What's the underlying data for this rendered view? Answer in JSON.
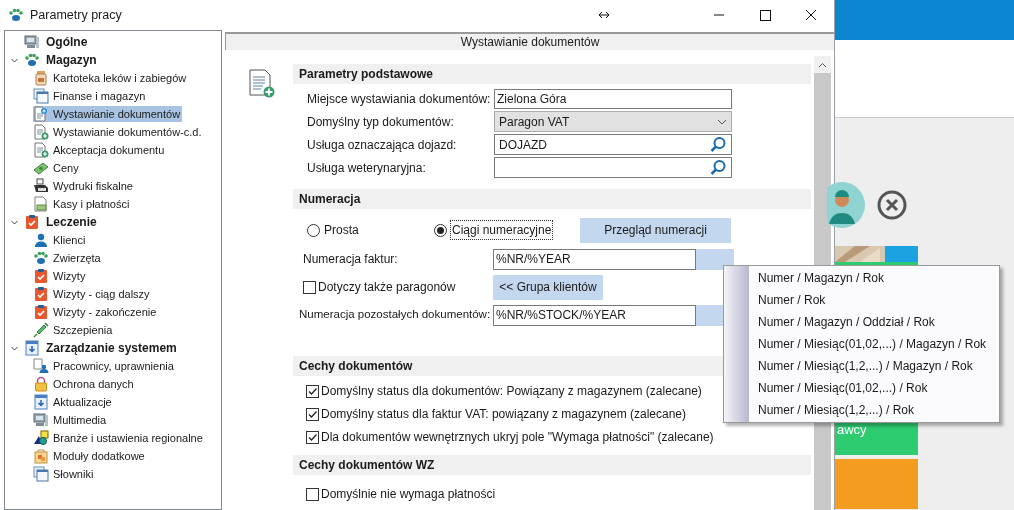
{
  "window": {
    "title": "Parametry pracy"
  },
  "tree": [
    {
      "label": "Ogólne",
      "selected": false
    },
    {
      "label": "Magazyn",
      "expanded": true,
      "selected": false,
      "children": [
        {
          "label": "Kartoteka leków i zabiegów",
          "selected": false
        },
        {
          "label": "Finanse i magazyn",
          "selected": false
        },
        {
          "label": "Wystawianie dokumentów",
          "selected": true
        },
        {
          "label": "Wystawianie dokumentów-c.d.",
          "selected": false
        },
        {
          "label": "Akceptacja dokumentu",
          "selected": false
        },
        {
          "label": "Ceny",
          "selected": false
        },
        {
          "label": "Wydruki fiskalne",
          "selected": false
        },
        {
          "label": "Kasy i płatności",
          "selected": false
        }
      ]
    },
    {
      "label": "Leczenie",
      "expanded": true,
      "selected": false,
      "children": [
        {
          "label": "Klienci",
          "selected": false
        },
        {
          "label": "Zwierzęta",
          "selected": false
        },
        {
          "label": "Wizyty",
          "selected": false
        },
        {
          "label": "Wizyty - ciąg dalszy",
          "selected": false
        },
        {
          "label": "Wizyty - zakończenie",
          "selected": false
        },
        {
          "label": "Szczepienia",
          "selected": false
        }
      ]
    },
    {
      "label": "Zarządzanie systemem",
      "expanded": true,
      "selected": false,
      "children": [
        {
          "label": "Pracownicy, uprawnienia",
          "selected": false
        },
        {
          "label": "Ochrona danych",
          "selected": false
        },
        {
          "label": "Aktualizacje",
          "selected": false
        },
        {
          "label": "Multimedia",
          "selected": false
        },
        {
          "label": "Branże i ustawienia regionalne",
          "selected": false
        },
        {
          "label": "Moduły dodatkowe",
          "selected": false
        },
        {
          "label": "Słowniki",
          "selected": false
        }
      ]
    }
  ],
  "panel": {
    "title": "Wystawianie dokumentów",
    "basic": {
      "title": "Parametry podstawowe",
      "fields": [
        {
          "kind": "text",
          "label": "Miejsce wystawiania dokumentów:",
          "value": "Zielona Góra"
        },
        {
          "kind": "select",
          "label": "Domyślny typ dokumentów:",
          "value": "Paragon VAT"
        },
        {
          "kind": "lookup",
          "label": "Usługa oznaczająca dojazd:",
          "value": "DOJAZD"
        },
        {
          "kind": "lookup",
          "label": "Usługa weterynaryjna:"
        }
      ]
    },
    "numbering": {
      "title": "Numeracja",
      "radios": [
        {
          "label": "Prosta",
          "selected": false
        },
        {
          "label": "Ciągi numeracyjne",
          "selected": true
        }
      ],
      "review_button": "Przegląd numeracji",
      "invoice_label": "Numeracja faktur:",
      "invoice_value": "%NR/%YEAR",
      "receipts_check": {
        "label": "Dotyczy także paragonów",
        "checked": false
      },
      "group_button": "<< Grupa klientów",
      "other_label": "Numeracja pozostałych dokumentów:",
      "other_value": "%NR/%STOCK/%YEAR"
    },
    "features": {
      "title": "Cechy dokumentów",
      "checks": [
        {
          "label": "Domyślny status dla dokumentów: Powiązany z magazynem (zalecane)",
          "checked": true
        },
        {
          "label": "Domyślny status dla faktur VAT: powiązany z magazynem (zalecane)",
          "checked": true
        },
        {
          "label": "Dla dokumentów wewnętrznych ukryj pole \"Wymaga płatności\" (zalecane)",
          "checked": true
        }
      ]
    },
    "wz": {
      "title": "Cechy dokumentów WZ",
      "checks": [
        {
          "label": "Domyślnie nie wymaga płatności",
          "checked": false
        }
      ]
    }
  },
  "menu": [
    "Numer / Magazyn / Rok",
    "Numer / Rok",
    "Numer / Magazyn / Oddział / Rok",
    "Numer / Miesiąc(01,02,...) / Magazyn / Rok",
    "Numer / Miesiąc(1,2,...) / Magazyn / Rok",
    "Numer / Miesiąc(01,02,...) / Rok",
    "Numer / Miesiąc(1,2,...) / Rok"
  ],
  "background": {
    "tile_text": "awcy"
  }
}
